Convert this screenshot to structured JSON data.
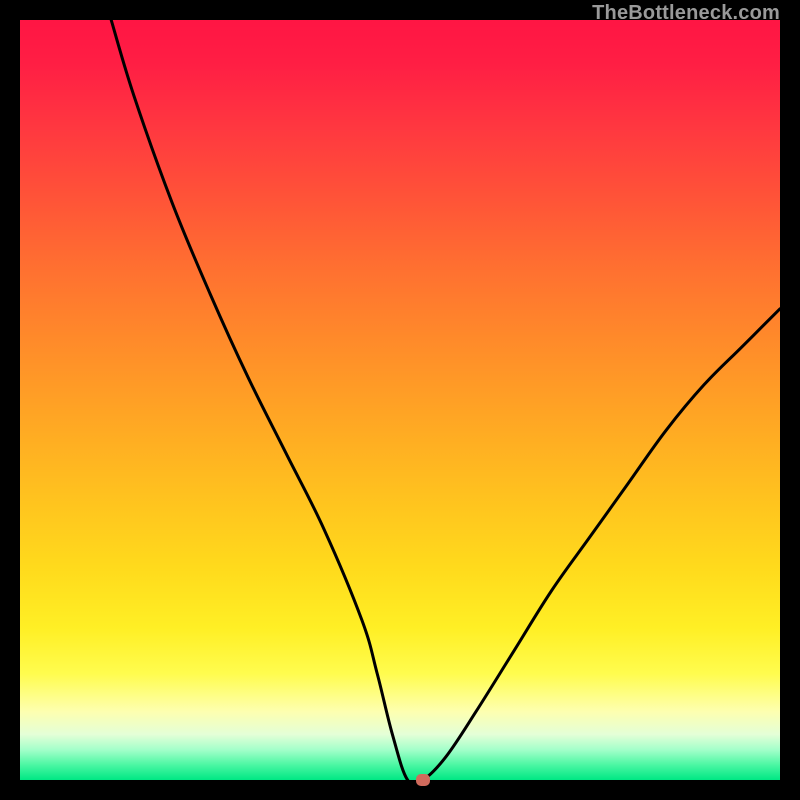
{
  "watermark": "TheBottleneck.com",
  "chart_data": {
    "type": "line",
    "title": "",
    "xlabel": "",
    "ylabel": "",
    "xlim": [
      0,
      100
    ],
    "ylim": [
      0,
      100
    ],
    "grid": false,
    "legend": false,
    "series": [
      {
        "name": "curve",
        "x": [
          12,
          15,
          20,
          25,
          30,
          35,
          40,
          45,
          47,
          49,
          51,
          53,
          56,
          60,
          65,
          70,
          75,
          80,
          85,
          90,
          95,
          100
        ],
        "y": [
          100,
          90,
          76,
          64,
          53,
          43,
          33,
          21,
          14,
          6,
          0,
          0,
          3,
          9,
          17,
          25,
          32,
          39,
          46,
          52,
          57,
          62
        ]
      }
    ],
    "marker": {
      "x": 53,
      "y": 0,
      "color": "#d06a5c"
    },
    "background_gradient": {
      "top": "#ff1544",
      "bottom": "#00e884"
    }
  }
}
